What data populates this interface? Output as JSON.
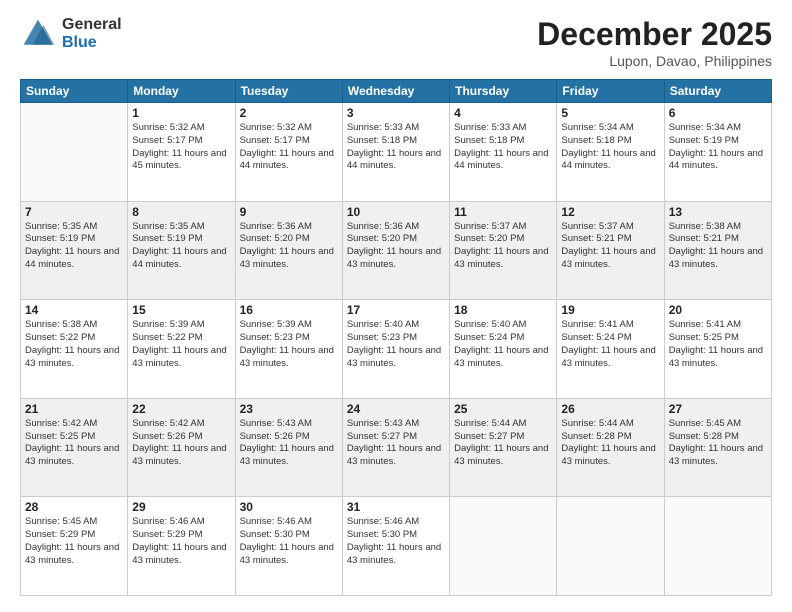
{
  "logo": {
    "general": "General",
    "blue": "Blue"
  },
  "header": {
    "month": "December 2025",
    "location": "Lupon, Davao, Philippines"
  },
  "weekdays": [
    "Sunday",
    "Monday",
    "Tuesday",
    "Wednesday",
    "Thursday",
    "Friday",
    "Saturday"
  ],
  "weeks": [
    [
      {
        "day": "",
        "sunrise": "",
        "sunset": "",
        "daylight": ""
      },
      {
        "day": "1",
        "sunrise": "Sunrise: 5:32 AM",
        "sunset": "Sunset: 5:17 PM",
        "daylight": "Daylight: 11 hours and 45 minutes."
      },
      {
        "day": "2",
        "sunrise": "Sunrise: 5:32 AM",
        "sunset": "Sunset: 5:17 PM",
        "daylight": "Daylight: 11 hours and 44 minutes."
      },
      {
        "day": "3",
        "sunrise": "Sunrise: 5:33 AM",
        "sunset": "Sunset: 5:18 PM",
        "daylight": "Daylight: 11 hours and 44 minutes."
      },
      {
        "day": "4",
        "sunrise": "Sunrise: 5:33 AM",
        "sunset": "Sunset: 5:18 PM",
        "daylight": "Daylight: 11 hours and 44 minutes."
      },
      {
        "day": "5",
        "sunrise": "Sunrise: 5:34 AM",
        "sunset": "Sunset: 5:18 PM",
        "daylight": "Daylight: 11 hours and 44 minutes."
      },
      {
        "day": "6",
        "sunrise": "Sunrise: 5:34 AM",
        "sunset": "Sunset: 5:19 PM",
        "daylight": "Daylight: 11 hours and 44 minutes."
      }
    ],
    [
      {
        "day": "7",
        "sunrise": "Sunrise: 5:35 AM",
        "sunset": "Sunset: 5:19 PM",
        "daylight": "Daylight: 11 hours and 44 minutes."
      },
      {
        "day": "8",
        "sunrise": "Sunrise: 5:35 AM",
        "sunset": "Sunset: 5:19 PM",
        "daylight": "Daylight: 11 hours and 44 minutes."
      },
      {
        "day": "9",
        "sunrise": "Sunrise: 5:36 AM",
        "sunset": "Sunset: 5:20 PM",
        "daylight": "Daylight: 11 hours and 43 minutes."
      },
      {
        "day": "10",
        "sunrise": "Sunrise: 5:36 AM",
        "sunset": "Sunset: 5:20 PM",
        "daylight": "Daylight: 11 hours and 43 minutes."
      },
      {
        "day": "11",
        "sunrise": "Sunrise: 5:37 AM",
        "sunset": "Sunset: 5:20 PM",
        "daylight": "Daylight: 11 hours and 43 minutes."
      },
      {
        "day": "12",
        "sunrise": "Sunrise: 5:37 AM",
        "sunset": "Sunset: 5:21 PM",
        "daylight": "Daylight: 11 hours and 43 minutes."
      },
      {
        "day": "13",
        "sunrise": "Sunrise: 5:38 AM",
        "sunset": "Sunset: 5:21 PM",
        "daylight": "Daylight: 11 hours and 43 minutes."
      }
    ],
    [
      {
        "day": "14",
        "sunrise": "Sunrise: 5:38 AM",
        "sunset": "Sunset: 5:22 PM",
        "daylight": "Daylight: 11 hours and 43 minutes."
      },
      {
        "day": "15",
        "sunrise": "Sunrise: 5:39 AM",
        "sunset": "Sunset: 5:22 PM",
        "daylight": "Daylight: 11 hours and 43 minutes."
      },
      {
        "day": "16",
        "sunrise": "Sunrise: 5:39 AM",
        "sunset": "Sunset: 5:23 PM",
        "daylight": "Daylight: 11 hours and 43 minutes."
      },
      {
        "day": "17",
        "sunrise": "Sunrise: 5:40 AM",
        "sunset": "Sunset: 5:23 PM",
        "daylight": "Daylight: 11 hours and 43 minutes."
      },
      {
        "day": "18",
        "sunrise": "Sunrise: 5:40 AM",
        "sunset": "Sunset: 5:24 PM",
        "daylight": "Daylight: 11 hours and 43 minutes."
      },
      {
        "day": "19",
        "sunrise": "Sunrise: 5:41 AM",
        "sunset": "Sunset: 5:24 PM",
        "daylight": "Daylight: 11 hours and 43 minutes."
      },
      {
        "day": "20",
        "sunrise": "Sunrise: 5:41 AM",
        "sunset": "Sunset: 5:25 PM",
        "daylight": "Daylight: 11 hours and 43 minutes."
      }
    ],
    [
      {
        "day": "21",
        "sunrise": "Sunrise: 5:42 AM",
        "sunset": "Sunset: 5:25 PM",
        "daylight": "Daylight: 11 hours and 43 minutes."
      },
      {
        "day": "22",
        "sunrise": "Sunrise: 5:42 AM",
        "sunset": "Sunset: 5:26 PM",
        "daylight": "Daylight: 11 hours and 43 minutes."
      },
      {
        "day": "23",
        "sunrise": "Sunrise: 5:43 AM",
        "sunset": "Sunset: 5:26 PM",
        "daylight": "Daylight: 11 hours and 43 minutes."
      },
      {
        "day": "24",
        "sunrise": "Sunrise: 5:43 AM",
        "sunset": "Sunset: 5:27 PM",
        "daylight": "Daylight: 11 hours and 43 minutes."
      },
      {
        "day": "25",
        "sunrise": "Sunrise: 5:44 AM",
        "sunset": "Sunset: 5:27 PM",
        "daylight": "Daylight: 11 hours and 43 minutes."
      },
      {
        "day": "26",
        "sunrise": "Sunrise: 5:44 AM",
        "sunset": "Sunset: 5:28 PM",
        "daylight": "Daylight: 11 hours and 43 minutes."
      },
      {
        "day": "27",
        "sunrise": "Sunrise: 5:45 AM",
        "sunset": "Sunset: 5:28 PM",
        "daylight": "Daylight: 11 hours and 43 minutes."
      }
    ],
    [
      {
        "day": "28",
        "sunrise": "Sunrise: 5:45 AM",
        "sunset": "Sunset: 5:29 PM",
        "daylight": "Daylight: 11 hours and 43 minutes."
      },
      {
        "day": "29",
        "sunrise": "Sunrise: 5:46 AM",
        "sunset": "Sunset: 5:29 PM",
        "daylight": "Daylight: 11 hours and 43 minutes."
      },
      {
        "day": "30",
        "sunrise": "Sunrise: 5:46 AM",
        "sunset": "Sunset: 5:30 PM",
        "daylight": "Daylight: 11 hours and 43 minutes."
      },
      {
        "day": "31",
        "sunrise": "Sunrise: 5:46 AM",
        "sunset": "Sunset: 5:30 PM",
        "daylight": "Daylight: 11 hours and 43 minutes."
      },
      {
        "day": "",
        "sunrise": "",
        "sunset": "",
        "daylight": ""
      },
      {
        "day": "",
        "sunrise": "",
        "sunset": "",
        "daylight": ""
      },
      {
        "day": "",
        "sunrise": "",
        "sunset": "",
        "daylight": ""
      }
    ]
  ]
}
